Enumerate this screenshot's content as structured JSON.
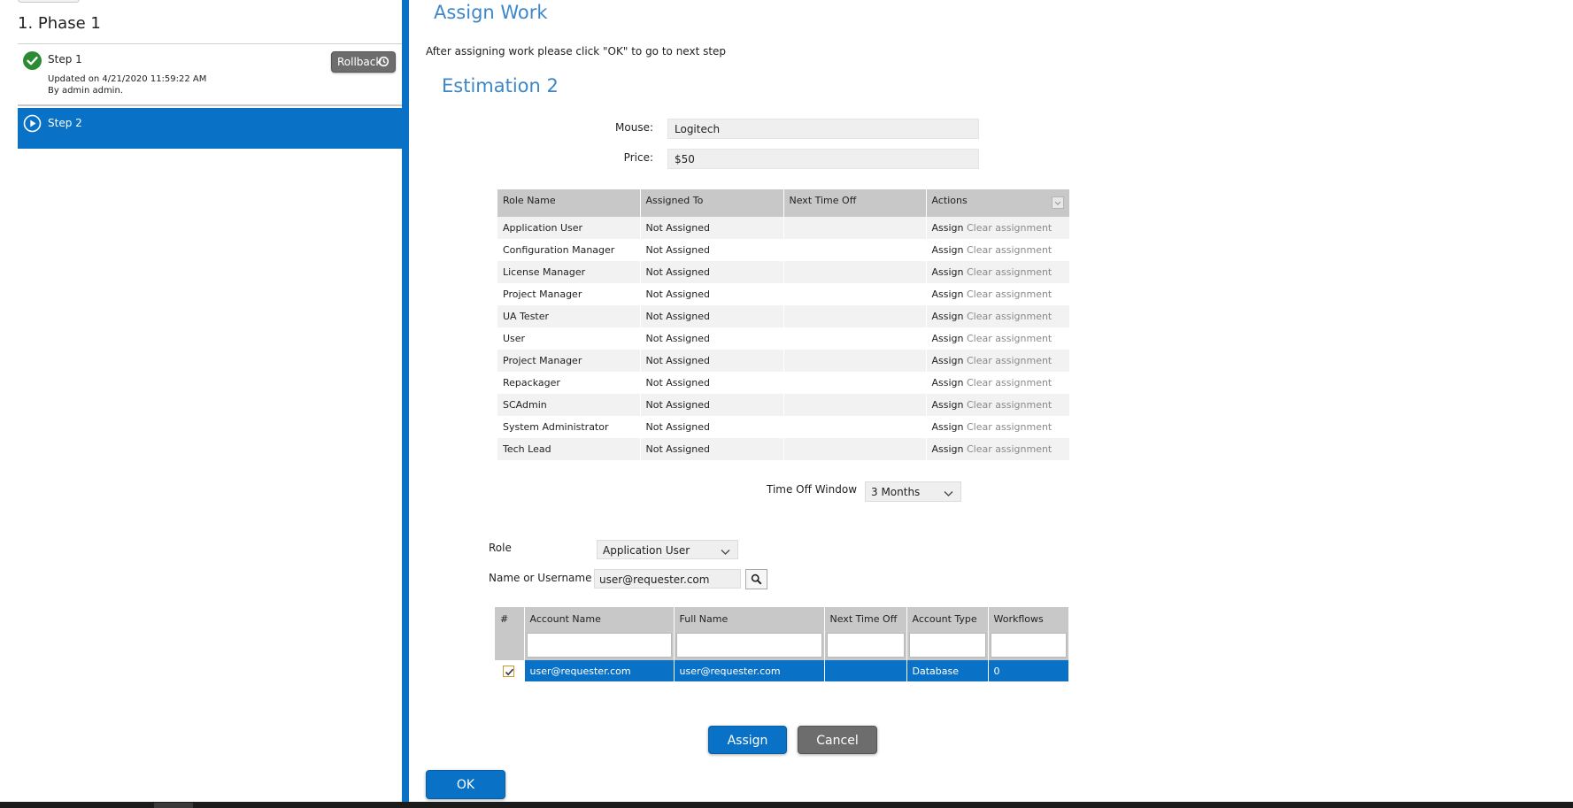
{
  "left": {
    "phase_title": "1. Phase 1",
    "steps": [
      {
        "name": "Step 1",
        "updated": "Updated on 4/21/2020 11:59:22 AM",
        "by": "By admin admin.",
        "status_icon": "check-circle-icon",
        "rollback_label": "Rollback"
      },
      {
        "name": "Step 2",
        "status_icon": "play-circle-icon"
      }
    ]
  },
  "main": {
    "title": "Assign Work",
    "instruction": "After assigning work please click \"OK\" to go to next step",
    "section_title": "Estimation 2",
    "fields": {
      "mouse_label": "Mouse:",
      "mouse_value": "Logitech",
      "price_label": "Price:",
      "price_value": "$50"
    },
    "role_table": {
      "headers": [
        "Role Name",
        "Assigned To",
        "Next Time Off",
        "Actions"
      ],
      "assign_label": "Assign",
      "clear_label": "Clear assignment",
      "rows": [
        {
          "role": "Application User",
          "assigned": "Not Assigned",
          "next_time_off": ""
        },
        {
          "role": "Configuration Manager",
          "assigned": "Not Assigned",
          "next_time_off": ""
        },
        {
          "role": "License Manager",
          "assigned": "Not Assigned",
          "next_time_off": ""
        },
        {
          "role": "Project Manager",
          "assigned": "Not Assigned",
          "next_time_off": ""
        },
        {
          "role": "UA Tester",
          "assigned": "Not Assigned",
          "next_time_off": ""
        },
        {
          "role": "User",
          "assigned": "Not Assigned",
          "next_time_off": ""
        },
        {
          "role": "Project Manager",
          "assigned": "Not Assigned",
          "next_time_off": ""
        },
        {
          "role": "Repackager",
          "assigned": "Not Assigned",
          "next_time_off": ""
        },
        {
          "role": "SCAdmin",
          "assigned": "Not Assigned",
          "next_time_off": ""
        },
        {
          "role": "System Administrator",
          "assigned": "Not Assigned",
          "next_time_off": ""
        },
        {
          "role": "Tech Lead",
          "assigned": "Not Assigned",
          "next_time_off": ""
        }
      ]
    },
    "time_off": {
      "label": "Time Off Window",
      "value": "3 Months"
    },
    "role_select": {
      "label": "Role",
      "value": "Application User"
    },
    "search": {
      "label": "Name or Username",
      "value": "user@requester.com"
    },
    "user_table": {
      "headers": [
        "#",
        "Account Name",
        "Full Name",
        "Next Time Off",
        "Account Type",
        "Workflows"
      ],
      "rows": [
        {
          "checked": true,
          "account_name": "user@requester.com",
          "full_name": "user@requester.com",
          "next_time_off": "",
          "account_type": "Database",
          "workflows": "0"
        }
      ]
    },
    "buttons": {
      "assign": "Assign",
      "cancel": "Cancel",
      "ok": "OK"
    },
    "colors": {
      "accent": "#0a72c6",
      "title": "#3d87c8",
      "success": "#2b8b33"
    }
  }
}
